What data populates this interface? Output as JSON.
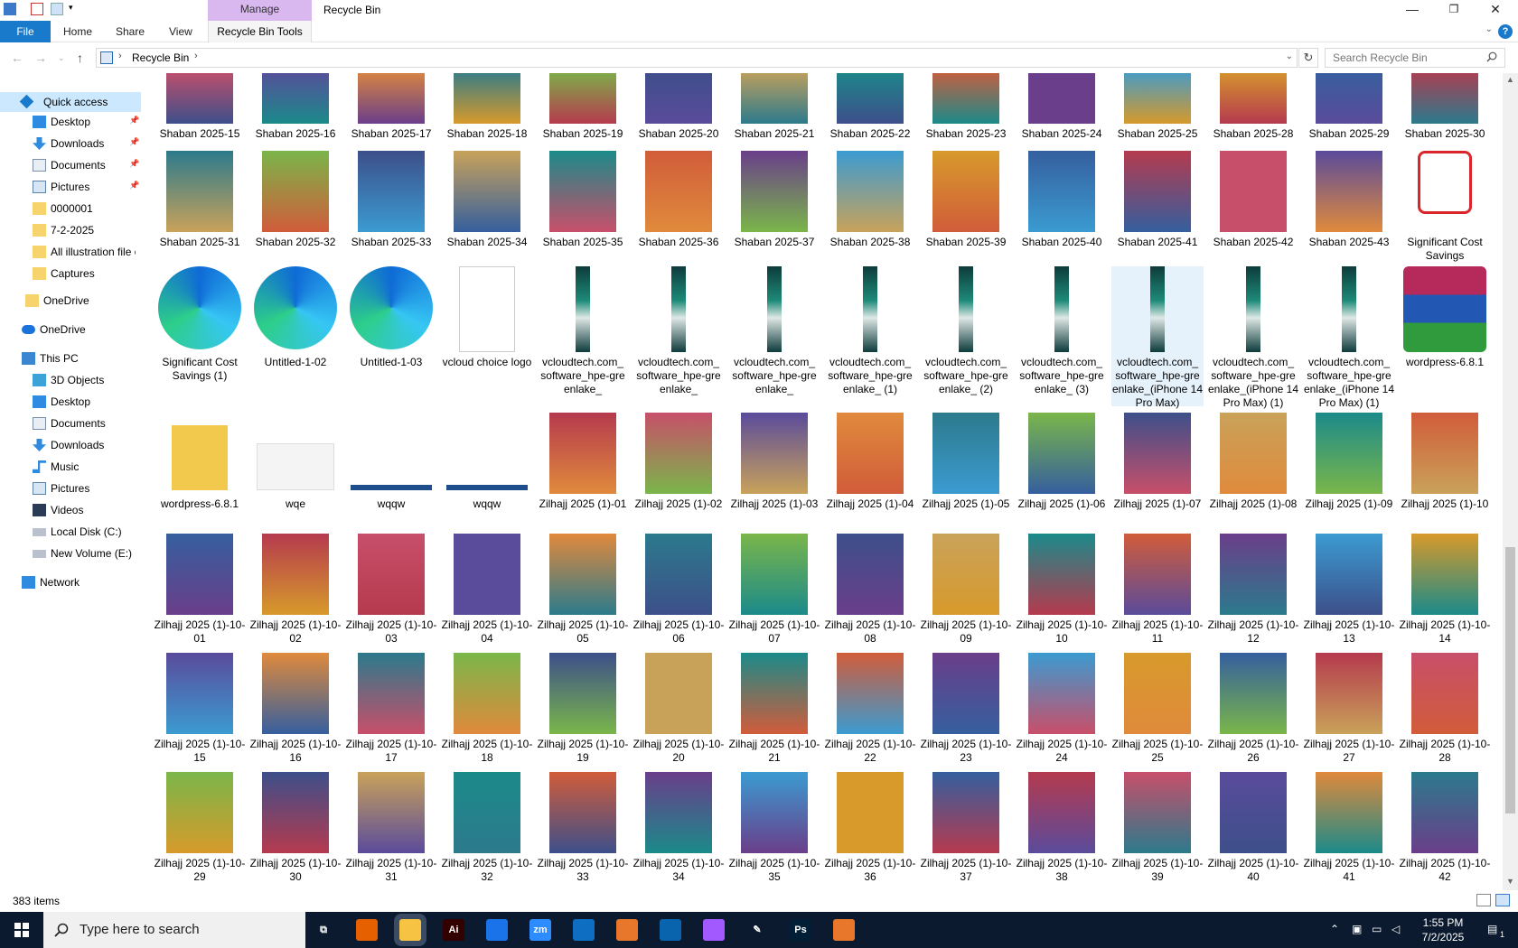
{
  "window": {
    "title": "Recycle Bin",
    "context_tab": "Manage",
    "tabs": [
      "File",
      "Home",
      "Share",
      "View",
      "Recycle Bin Tools"
    ]
  },
  "address": {
    "crumb": "Recycle Bin",
    "search_placeholder": "Search Recycle Bin"
  },
  "sidebar": {
    "items": [
      {
        "label": "Quick access",
        "icon": "star-icon"
      },
      {
        "label": "Desktop",
        "icon": "desktop-icon",
        "pinned": true
      },
      {
        "label": "Downloads",
        "icon": "download-icon",
        "pinned": true
      },
      {
        "label": "Documents",
        "icon": "documents-icon",
        "pinned": true
      },
      {
        "label": "Pictures",
        "icon": "pictures-icon",
        "pinned": true
      },
      {
        "label": "0000001",
        "icon": "folder-icon"
      },
      {
        "label": "7-2-2025",
        "icon": "folder-icon"
      },
      {
        "label": "All illustration file o",
        "icon": "folder-icon"
      },
      {
        "label": "Captures",
        "icon": "folder-icon"
      },
      {
        "label": "OneDrive",
        "icon": "folder-icon"
      },
      {
        "label": "OneDrive",
        "icon": "cloud-icon"
      },
      {
        "label": "This PC",
        "icon": "computer-icon"
      },
      {
        "label": "3D Objects",
        "icon": "cube-icon"
      },
      {
        "label": "Desktop",
        "icon": "desktop-icon"
      },
      {
        "label": "Documents",
        "icon": "documents-icon"
      },
      {
        "label": "Downloads",
        "icon": "download-icon"
      },
      {
        "label": "Music",
        "icon": "music-icon"
      },
      {
        "label": "Pictures",
        "icon": "pictures-icon"
      },
      {
        "label": "Videos",
        "icon": "videos-icon"
      },
      {
        "label": "Local Disk (C:)",
        "icon": "drive-icon"
      },
      {
        "label": "New Volume (E:)",
        "icon": "drive-icon"
      },
      {
        "label": "Network",
        "icon": "network-icon"
      }
    ]
  },
  "files": {
    "row1": [
      "Shaban 2025-15",
      "Shaban 2025-16",
      "Shaban 2025-17",
      "Shaban 2025-18",
      "Shaban 2025-19",
      "Shaban 2025-20",
      "Shaban 2025-21",
      "Shaban 2025-22",
      "Shaban 2025-23",
      "Shaban 2025-24",
      "Shaban 2025-25",
      "Shaban 2025-28",
      "Shaban 2025-29",
      "Shaban 2025-30"
    ],
    "row2": [
      "Shaban 2025-31",
      "Shaban 2025-32",
      "Shaban 2025-33",
      "Shaban 2025-34",
      "Shaban 2025-35",
      "Shaban 2025-36",
      "Shaban 2025-37",
      "Shaban 2025-38",
      "Shaban 2025-39",
      "Shaban 2025-40",
      "Shaban 2025-41",
      "Shaban 2025-42",
      "Shaban 2025-43",
      "Significant Cost Savings"
    ],
    "row3": [
      "Significant Cost Savings (1)",
      "Untitled-1-02",
      "Untitled-1-03",
      "vcloud choice logo",
      "vcloudtech.com_ software_hpe-gre enlake_",
      "vcloudtech.com_ software_hpe-gre enlake_",
      "vcloudtech.com_ software_hpe-gre enlake_",
      "vcloudtech.com_ software_hpe-gre enlake_ (1)",
      "vcloudtech.com_ software_hpe-gre enlake_ (2)",
      "vcloudtech.com_ software_hpe-gre enlake_ (3)",
      "vcloudtech.com_ software_hpe-gre enlake_(iPhone 14 Pro Max)",
      "vcloudtech.com_ software_hpe-gre enlake_(iPhone 14 Pro Max) (1)",
      "vcloudtech.com_ software_hpe-gre enlake_(iPhone 14 Pro Max) (1)",
      "wordpress-6.8.1"
    ],
    "row4": [
      "wordpress-6.8.1",
      "wqe",
      "wqqw",
      "wqqw",
      "Zilhajj 2025 (1)-01",
      "Zilhajj 2025 (1)-02",
      "Zilhajj 2025 (1)-03",
      "Zilhajj 2025 (1)-04",
      "Zilhajj 2025 (1)-05",
      "Zilhajj 2025 (1)-06",
      "Zilhajj 2025 (1)-07",
      "Zilhajj 2025 (1)-08",
      "Zilhajj 2025 (1)-09",
      "Zilhajj 2025 (1)-10"
    ],
    "row5": [
      "Zilhajj 2025 (1)-10-01",
      "Zilhajj 2025 (1)-10-02",
      "Zilhajj 2025 (1)-10-03",
      "Zilhajj 2025 (1)-10-04",
      "Zilhajj 2025 (1)-10-05",
      "Zilhajj 2025 (1)-10-06",
      "Zilhajj 2025 (1)-10-07",
      "Zilhajj 2025 (1)-10-08",
      "Zilhajj 2025 (1)-10-09",
      "Zilhajj 2025 (1)-10-10",
      "Zilhajj 2025 (1)-10-11",
      "Zilhajj 2025 (1)-10-12",
      "Zilhajj 2025 (1)-10-13",
      "Zilhajj 2025 (1)-10-14"
    ],
    "row6": [
      "Zilhajj 2025 (1)-10-15",
      "Zilhajj 2025 (1)-10-16",
      "Zilhajj 2025 (1)-10-17",
      "Zilhajj 2025 (1)-10-18",
      "Zilhajj 2025 (1)-10-19",
      "Zilhajj 2025 (1)-10-20",
      "Zilhajj 2025 (1)-10-21",
      "Zilhajj 2025 (1)-10-22",
      "Zilhajj 2025 (1)-10-23",
      "Zilhajj 2025 (1)-10-24",
      "Zilhajj 2025 (1)-10-25",
      "Zilhajj 2025 (1)-10-26",
      "Zilhajj 2025 (1)-10-27",
      "Zilhajj 2025 (1)-10-28"
    ],
    "row7": [
      "Zilhajj 2025 (1)-10-29",
      "Zilhajj 2025 (1)-10-30",
      "Zilhajj 2025 (1)-10-31",
      "Zilhajj 2025 (1)-10-32",
      "Zilhajj 2025 (1)-10-33",
      "Zilhajj 2025 (1)-10-34",
      "Zilhajj 2025 (1)-10-35",
      "Zilhajj 2025 (1)-10-36",
      "Zilhajj 2025 (1)-10-37",
      "Zilhajj 2025 (1)-10-38",
      "Zilhajj 2025 (1)-10-39",
      "Zilhajj 2025 (1)-10-40",
      "Zilhajj 2025 (1)-10-41",
      "Zilhajj 2025 (1)-10-42"
    ]
  },
  "status": {
    "item_count": "383 items"
  },
  "taskbar": {
    "search_placeholder": "Type here to search",
    "time": "1:55 PM",
    "date": "7/2/2025",
    "notification_count": "1",
    "apps": [
      "task-view-icon",
      "firefox-icon",
      "file-explorer-icon",
      "illustrator-icon",
      "chrome-icon",
      "zoom-icon",
      "vscode-icon",
      "app-icon",
      "outlook-icon",
      "figma-icon",
      "pen-icon",
      "photoshop-icon",
      "app-icon"
    ]
  },
  "colors": {
    "accent": "#1979ca",
    "manage_tab": "#d9b8f0",
    "taskbar": "#0b1a2e"
  }
}
